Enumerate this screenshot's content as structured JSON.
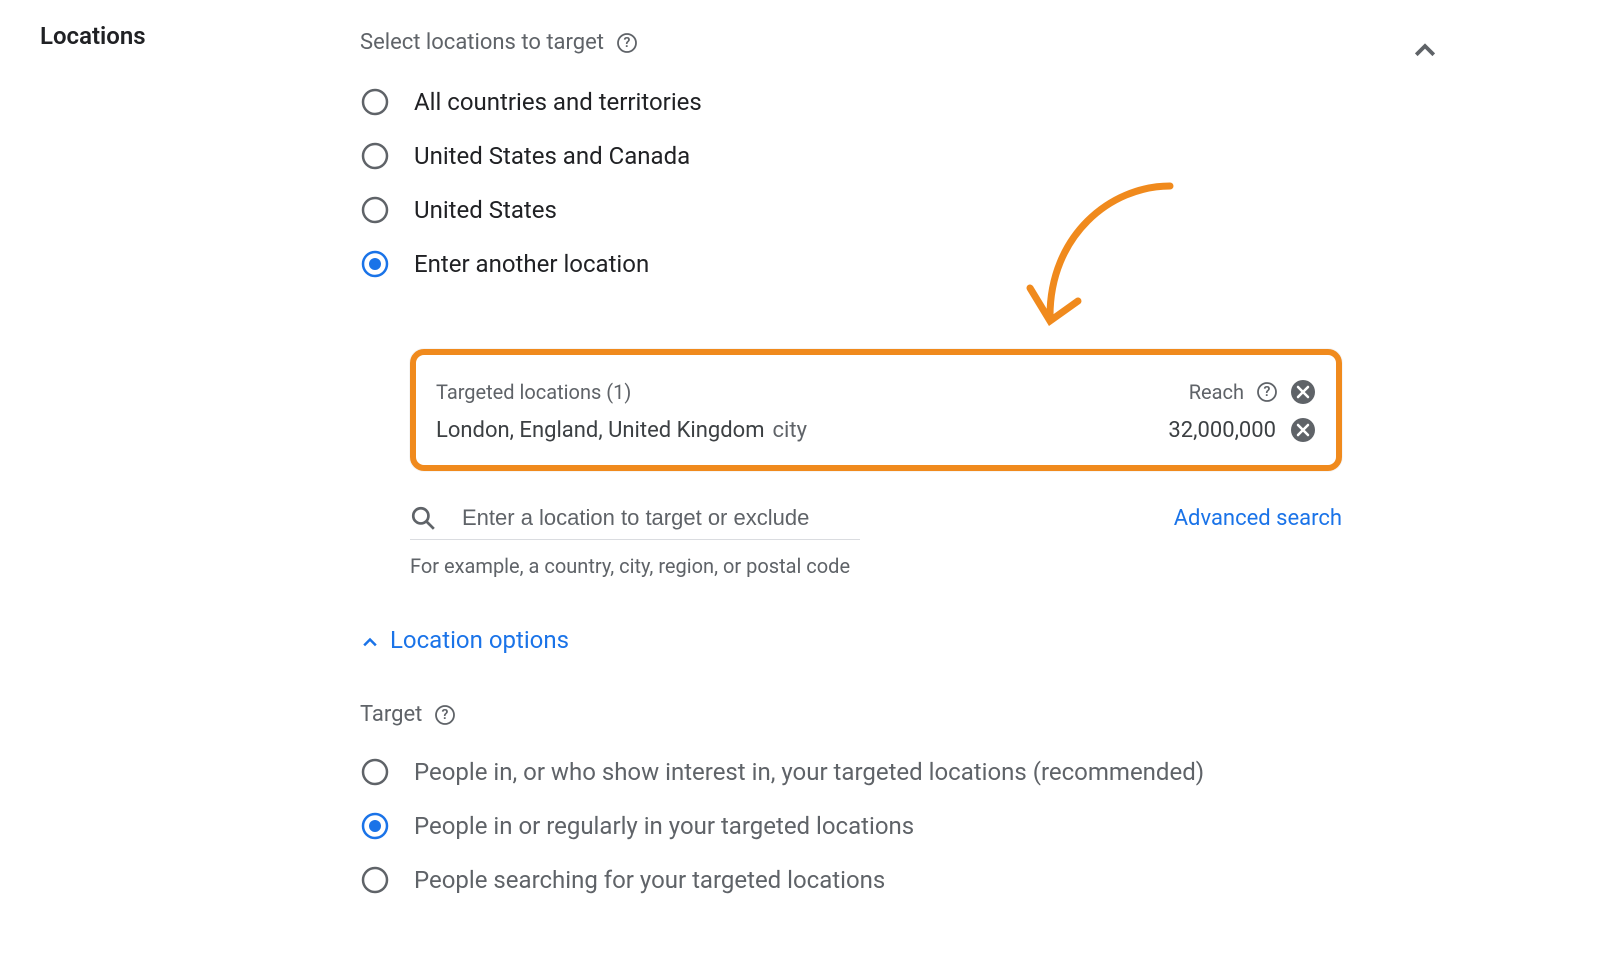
{
  "section": {
    "title": "Locations",
    "select_label": "Select locations to target"
  },
  "radios": [
    {
      "label": "All countries and territories",
      "checked": false
    },
    {
      "label": "United States and Canada",
      "checked": false
    },
    {
      "label": "United States",
      "checked": false
    },
    {
      "label": "Enter another location",
      "checked": true
    }
  ],
  "targeted": {
    "header": "Targeted locations (1)",
    "reach_label": "Reach",
    "items": [
      {
        "name": "London, England, United Kingdom",
        "type": "city",
        "reach": "32,000,000"
      }
    ]
  },
  "search": {
    "placeholder": "Enter a location to target or exclude",
    "advanced": "Advanced search",
    "example": "For example, a country, city, region, or postal code"
  },
  "location_options_label": "Location options",
  "target": {
    "label": "Target",
    "options": [
      {
        "label": "People in, or who show interest in, your targeted locations (recommended)",
        "checked": false
      },
      {
        "label": "People in or regularly in your targeted locations",
        "checked": true
      },
      {
        "label": "People searching for your targeted locations",
        "checked": false
      }
    ]
  }
}
